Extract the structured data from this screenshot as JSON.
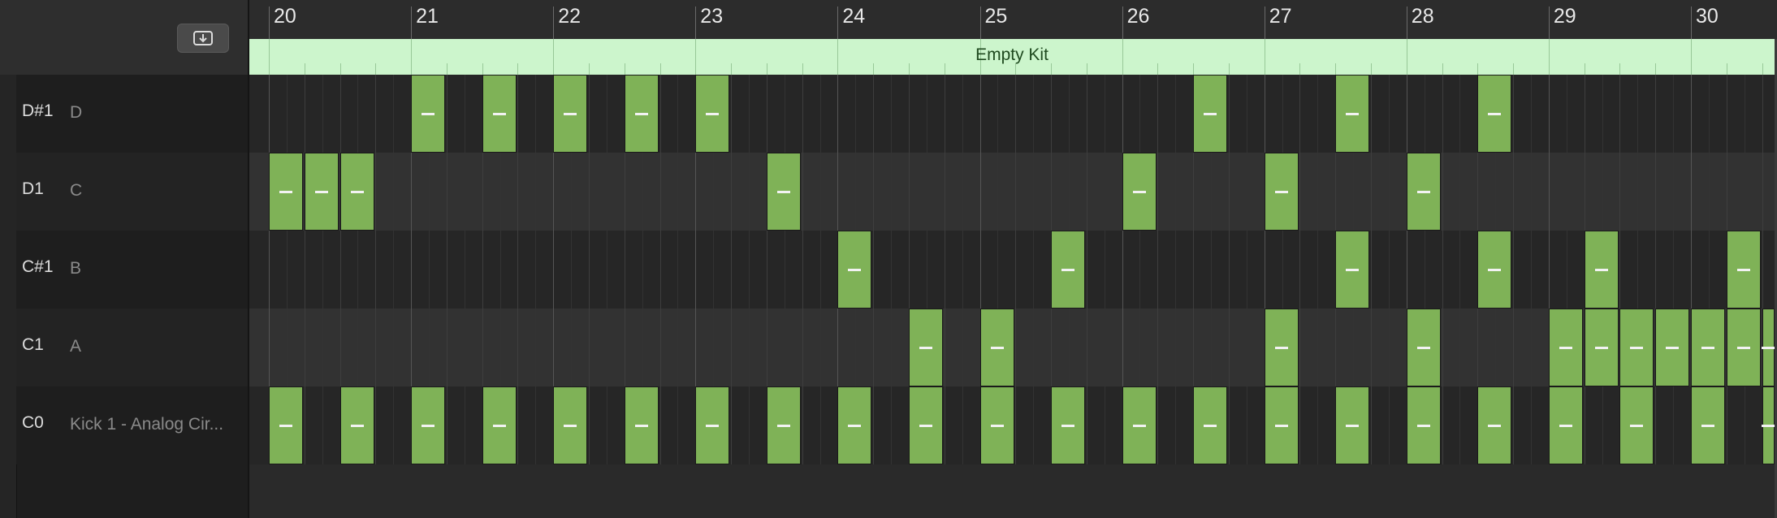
{
  "toolbar": {
    "import_icon": "download-tray-icon"
  },
  "ruler": {
    "bars": [
      "20",
      "21",
      "22",
      "23",
      "24",
      "25",
      "26",
      "27",
      "28",
      "29",
      "30"
    ]
  },
  "region": {
    "title": "Empty Kit",
    "color": "#ccf5cc"
  },
  "colors": {
    "note": "#7fb257",
    "background": "#2a2a2a",
    "row_alt": "#323232",
    "row_dark": "#262626"
  },
  "rows": [
    {
      "pitch": "D#1",
      "name": "D",
      "notes": [
        21,
        21.5,
        22,
        22.5,
        23,
        26.5,
        27.5,
        28.5
      ]
    },
    {
      "pitch": "D1",
      "name": "C",
      "notes": [
        20,
        20.25,
        20.5,
        23.5,
        26,
        27,
        28
      ]
    },
    {
      "pitch": "C#1",
      "name": "B",
      "notes": [
        24,
        25.5,
        27.5,
        28.5,
        29.25,
        30.25
      ]
    },
    {
      "pitch": "C1",
      "name": "A",
      "notes": [
        24.5,
        25,
        27,
        28,
        29,
        29.25,
        29.5,
        29.75,
        30,
        30.25,
        30.5
      ]
    },
    {
      "pitch": "C0",
      "name": "Kick 1 - Analog Cir...",
      "notes": [
        20,
        20.5,
        21,
        21.5,
        22,
        22.5,
        23,
        23.5,
        24,
        24.5,
        25,
        25.5,
        26,
        26.5,
        27,
        27.5,
        28,
        28.5,
        29,
        29.5,
        30,
        30.5
      ]
    }
  ]
}
